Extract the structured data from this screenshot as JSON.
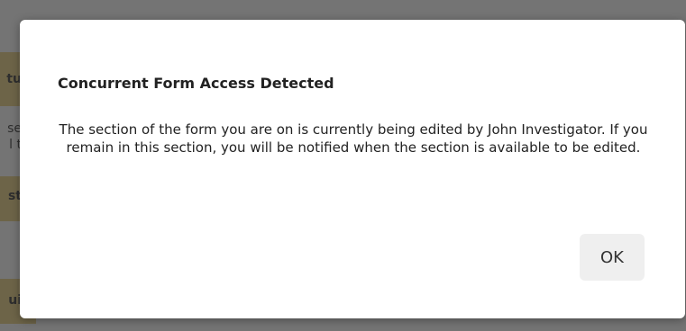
{
  "dialog": {
    "title": "Concurrent Form Access Detected",
    "message": "The section of the form you are on is currently being edited by John Investigator. If you remain in this section, you will be notified when the section is available to be edited.",
    "ok_label": "OK"
  },
  "background": {
    "fragments": [
      "tu",
      "se",
      "l t",
      "st",
      "ui"
    ]
  }
}
